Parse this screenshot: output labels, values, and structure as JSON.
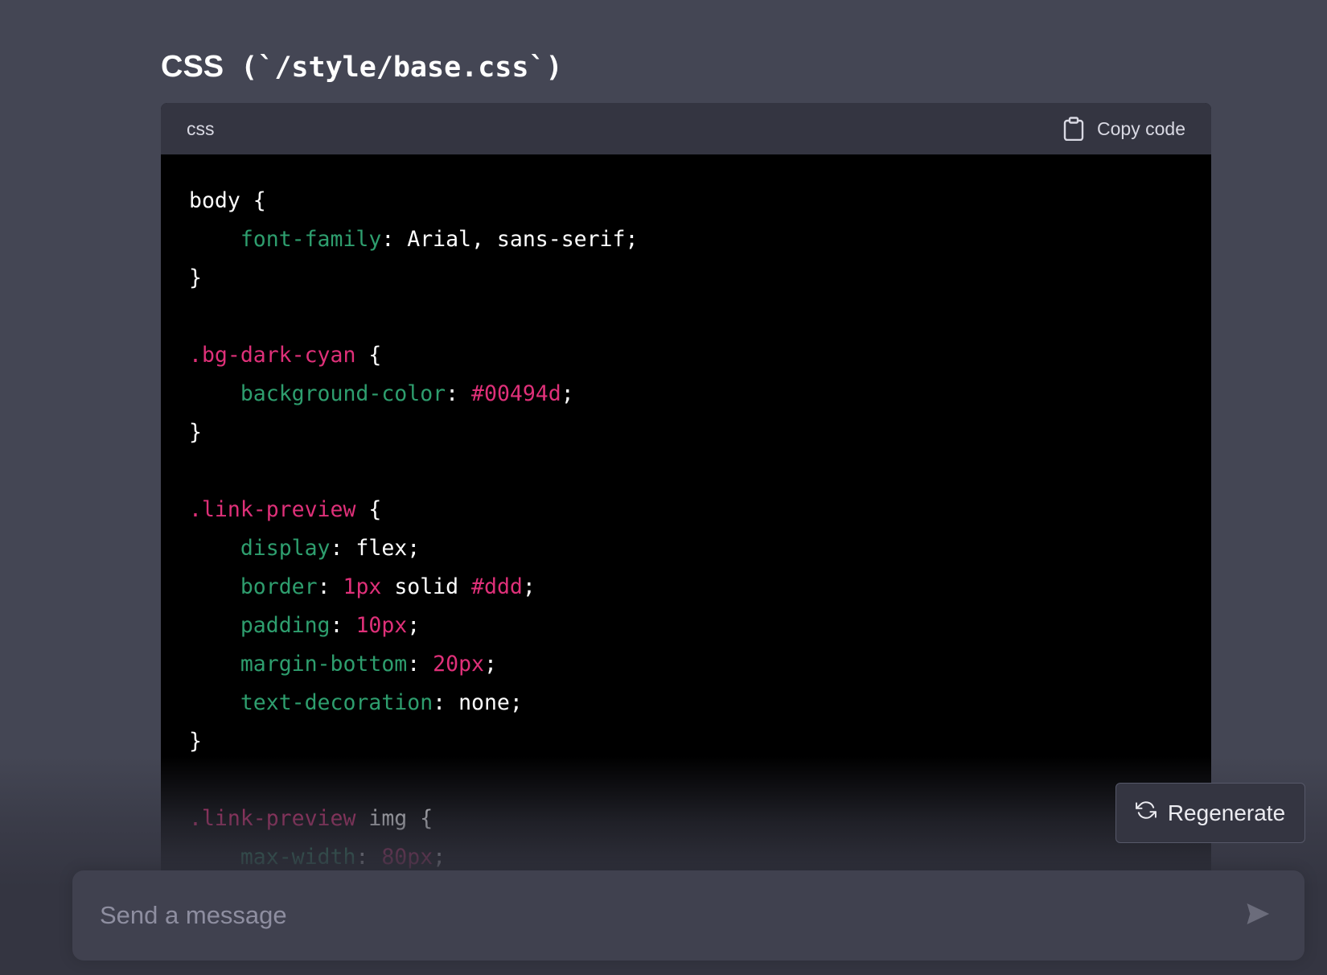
{
  "heading": {
    "prefix": "CSS",
    "code": " (`/style/base.css`)"
  },
  "code_block": {
    "language": "css",
    "copy_label": "Copy code",
    "lines": [
      [
        {
          "t": "body {",
          "k": "value"
        }
      ],
      [
        {
          "t": "    ",
          "k": "value"
        },
        {
          "t": "font-family",
          "k": "prop"
        },
        {
          "t": ": Arial, sans-serif;",
          "k": "value"
        }
      ],
      [
        {
          "t": "}",
          "k": "value"
        }
      ],
      [],
      [
        {
          "t": ".bg-dark-cyan",
          "k": "selector"
        },
        {
          "t": " {",
          "k": "value"
        }
      ],
      [
        {
          "t": "    ",
          "k": "value"
        },
        {
          "t": "background-color",
          "k": "prop"
        },
        {
          "t": ": ",
          "k": "value"
        },
        {
          "t": "#00494d",
          "k": "num"
        },
        {
          "t": ";",
          "k": "value"
        }
      ],
      [
        {
          "t": "}",
          "k": "value"
        }
      ],
      [],
      [
        {
          "t": ".link-preview",
          "k": "selector"
        },
        {
          "t": " {",
          "k": "value"
        }
      ],
      [
        {
          "t": "    ",
          "k": "value"
        },
        {
          "t": "display",
          "k": "prop"
        },
        {
          "t": ": flex;",
          "k": "value"
        }
      ],
      [
        {
          "t": "    ",
          "k": "value"
        },
        {
          "t": "border",
          "k": "prop"
        },
        {
          "t": ": ",
          "k": "value"
        },
        {
          "t": "1px",
          "k": "num"
        },
        {
          "t": " solid ",
          "k": "value"
        },
        {
          "t": "#ddd",
          "k": "num"
        },
        {
          "t": ";",
          "k": "value"
        }
      ],
      [
        {
          "t": "    ",
          "k": "value"
        },
        {
          "t": "padding",
          "k": "prop"
        },
        {
          "t": ": ",
          "k": "value"
        },
        {
          "t": "10px",
          "k": "num"
        },
        {
          "t": ";",
          "k": "value"
        }
      ],
      [
        {
          "t": "    ",
          "k": "value"
        },
        {
          "t": "margin-bottom",
          "k": "prop"
        },
        {
          "t": ": ",
          "k": "value"
        },
        {
          "t": "20px",
          "k": "num"
        },
        {
          "t": ";",
          "k": "value"
        }
      ],
      [
        {
          "t": "    ",
          "k": "value"
        },
        {
          "t": "text-decoration",
          "k": "prop"
        },
        {
          "t": ": none;",
          "k": "value"
        }
      ],
      [
        {
          "t": "}",
          "k": "value"
        }
      ],
      [],
      [
        {
          "t": ".link-preview",
          "k": "selector"
        },
        {
          "t": " img {",
          "k": "value"
        }
      ],
      [
        {
          "t": "    ",
          "k": "value"
        },
        {
          "t": "max-width",
          "k": "prop"
        },
        {
          "t": ": ",
          "k": "value"
        },
        {
          "t": "80px",
          "k": "num"
        },
        {
          "t": ";",
          "k": "value"
        }
      ]
    ]
  },
  "regenerate": {
    "label": "Regenerate"
  },
  "composer": {
    "placeholder": "Send a message"
  },
  "colors": {
    "page_bg": "#444654",
    "code_header_bg": "#343541",
    "code_bg": "#000000",
    "selector": "#df3079",
    "property": "#2e9e6e",
    "number": "#df3079",
    "composer_bg": "#40414f"
  }
}
